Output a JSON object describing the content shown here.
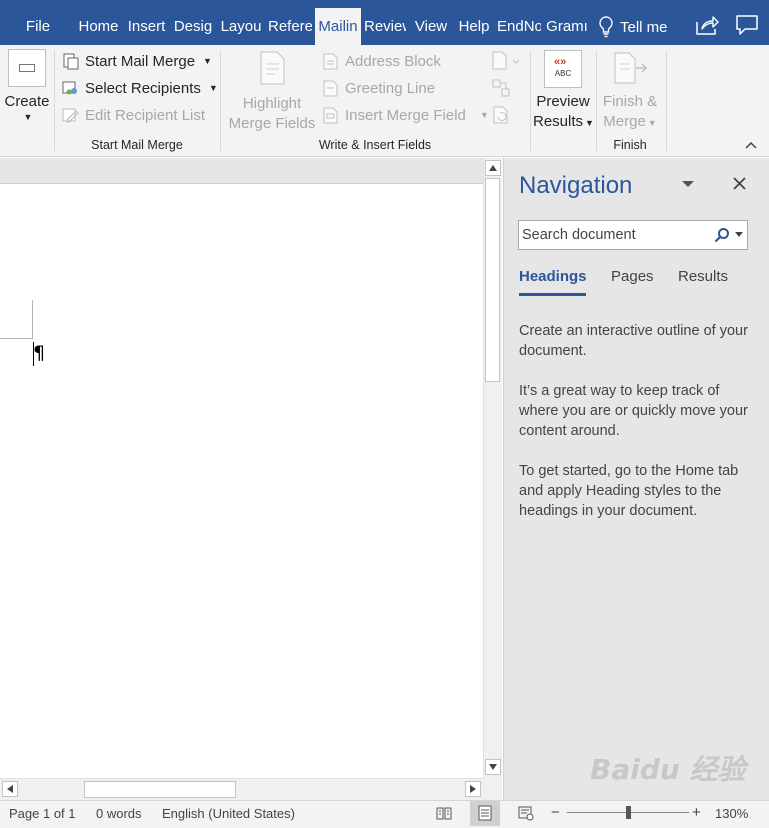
{
  "tabs": [
    {
      "label": "File",
      "active": false
    },
    {
      "label": "Home",
      "active": false
    },
    {
      "label": "Insert",
      "active": false
    },
    {
      "label": "Desig",
      "active": false
    },
    {
      "label": "Layou",
      "active": false
    },
    {
      "label": "Refere",
      "active": false
    },
    {
      "label": "Mailin",
      "active": true
    },
    {
      "label": "Review",
      "active": false
    },
    {
      "label": "View",
      "active": false
    },
    {
      "label": "Help",
      "active": false
    },
    {
      "label": "EndNo",
      "active": false
    },
    {
      "label": "Gramı",
      "active": false
    }
  ],
  "tell_me": "Tell me",
  "ribbon": {
    "create": "Create",
    "start_mail_merge": "Start Mail Merge",
    "select_recipients": "Select Recipients",
    "edit_recipient_list": "Edit Recipient List",
    "group_start": "Start Mail Merge",
    "highlight_line1": "Highlight",
    "highlight_line2": "Merge Fields",
    "address_block": "Address Block",
    "greeting_line": "Greeting Line",
    "insert_merge_field": "Insert Merge Field",
    "group_write": "Write & Insert Fields",
    "preview_line1": "Preview",
    "preview_line2": "Results",
    "preview_icon_text": "ABC",
    "finish_line1": "Finish &",
    "finish_line2": "Merge",
    "group_finish": "Finish"
  },
  "document": {
    "pilcrow": "¶"
  },
  "navigation": {
    "title": "Navigation",
    "search_placeholder": "Search document",
    "tabs": [
      "Headings",
      "Pages",
      "Results"
    ],
    "active_tab": "Headings",
    "help": [
      "Create an interactive outline of your document.",
      "It’s a great way to keep track of where you are or quickly move your content around.",
      "To get started, go to the Home tab and apply Heading styles to the headings in your document."
    ]
  },
  "status": {
    "page": "Page 1 of 1",
    "words": "0 words",
    "language": "English (United States)",
    "zoom": "130%",
    "zoom_fraction": 0.5
  },
  "watermark": "Baidu 经验",
  "colors": {
    "accent": "#2b579a",
    "ribbon_bg": "#f3f3f3",
    "nav_bg": "#e6e6e6"
  }
}
